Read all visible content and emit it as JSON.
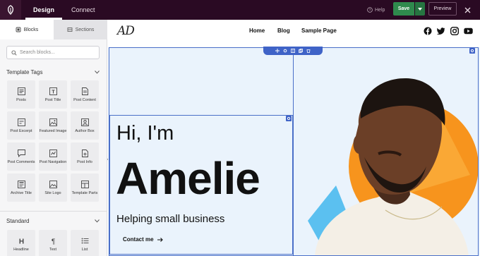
{
  "topbar": {
    "tabs": [
      {
        "label": "Design",
        "active": true
      },
      {
        "label": "Connect",
        "active": false
      }
    ],
    "help_label": "Help",
    "save_label": "Save",
    "preview_label": "Preview"
  },
  "sidebar": {
    "tabs": [
      {
        "label": "Blocks",
        "active": true
      },
      {
        "label": "Sections",
        "active": false
      }
    ],
    "search_placeholder": "Search blocks...",
    "template_tags": {
      "title": "Template Tags",
      "blocks": [
        {
          "label": "Posts",
          "icon": "posts-icon"
        },
        {
          "label": "Post Title",
          "icon": "post-title-icon"
        },
        {
          "label": "Post Content",
          "icon": "post-content-icon"
        },
        {
          "label": "Post Excerpt",
          "icon": "post-excerpt-icon"
        },
        {
          "label": "Featured Image",
          "icon": "featured-image-icon"
        },
        {
          "label": "Author Box",
          "icon": "author-box-icon"
        },
        {
          "label": "Post Comments",
          "icon": "post-comments-icon"
        },
        {
          "label": "Post Navigation",
          "icon": "post-navigation-icon"
        },
        {
          "label": "Post Info",
          "icon": "post-info-icon"
        },
        {
          "label": "Archive Title",
          "icon": "archive-title-icon"
        },
        {
          "label": "Site Logo",
          "icon": "site-logo-icon"
        },
        {
          "label": "Template Parts",
          "icon": "template-parts-icon"
        }
      ]
    },
    "standard": {
      "title": "Standard",
      "blocks": [
        {
          "label": "Headline",
          "icon": "headline-icon"
        },
        {
          "label": "Text",
          "icon": "text-icon"
        },
        {
          "label": "List",
          "icon": "list-icon"
        }
      ]
    }
  },
  "canvas": {
    "site_logo": "AD",
    "nav": [
      "Home",
      "Blog",
      "Sample Page"
    ],
    "social_icons": [
      "facebook-icon",
      "twitter-icon",
      "instagram-icon",
      "youtube-icon"
    ],
    "hero": {
      "greeting": "Hi, I'm",
      "name": "Amelie",
      "tagline": "Helping small business",
      "cta": "Contact me"
    }
  },
  "colors": {
    "topbar_bg": "#2a0a23",
    "save_green": "#2f8a4d",
    "selection_blue": "#3f63c7",
    "section_bg": "#eaf3fc",
    "accent_orange": "#f7941d"
  }
}
